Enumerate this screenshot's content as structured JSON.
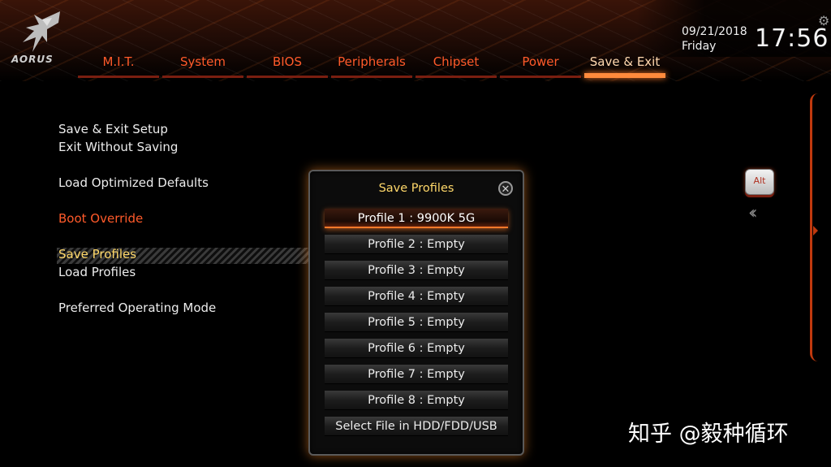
{
  "header": {
    "logo_text": "AORUS",
    "tabs": [
      {
        "label": "M.I.T."
      },
      {
        "label": "System"
      },
      {
        "label": "BIOS"
      },
      {
        "label": "Peripherals"
      },
      {
        "label": "Chipset"
      },
      {
        "label": "Power"
      },
      {
        "label": "Save & Exit"
      }
    ],
    "active_tab": "Save & Exit",
    "date": "09/21/2018",
    "day": "Friday",
    "time": "17:56"
  },
  "menu": {
    "items": [
      {
        "label": "Save & Exit Setup"
      },
      {
        "label": "Exit Without Saving"
      },
      {
        "label": "Load Optimized Defaults"
      },
      {
        "label": "Boot Override"
      },
      {
        "label": "Save Profiles"
      },
      {
        "label": "Load Profiles"
      },
      {
        "label": "Preferred Operating Mode"
      }
    ],
    "selected": "Save Profiles"
  },
  "modal": {
    "title": "Save Profiles",
    "close_glyph": "✕",
    "profiles": [
      {
        "label": "Profile 1 : 9900K 5G"
      },
      {
        "label": "Profile 2 : Empty"
      },
      {
        "label": "Profile 3 : Empty"
      },
      {
        "label": "Profile 4 : Empty"
      },
      {
        "label": "Profile 5 : Empty"
      },
      {
        "label": "Profile 6 : Empty"
      },
      {
        "label": "Profile 7 : Empty"
      },
      {
        "label": "Profile 8 : Empty"
      }
    ],
    "file_button": "Select File in HDD/FDD/USB"
  },
  "side": {
    "alt_label": "Alt",
    "collapse_glyph": "‹‹"
  },
  "watermark": "知乎 @毅种循环",
  "colors": {
    "accent": "#ff5a2a",
    "highlight": "#ffd86a",
    "glow": "#ff7a2a"
  }
}
